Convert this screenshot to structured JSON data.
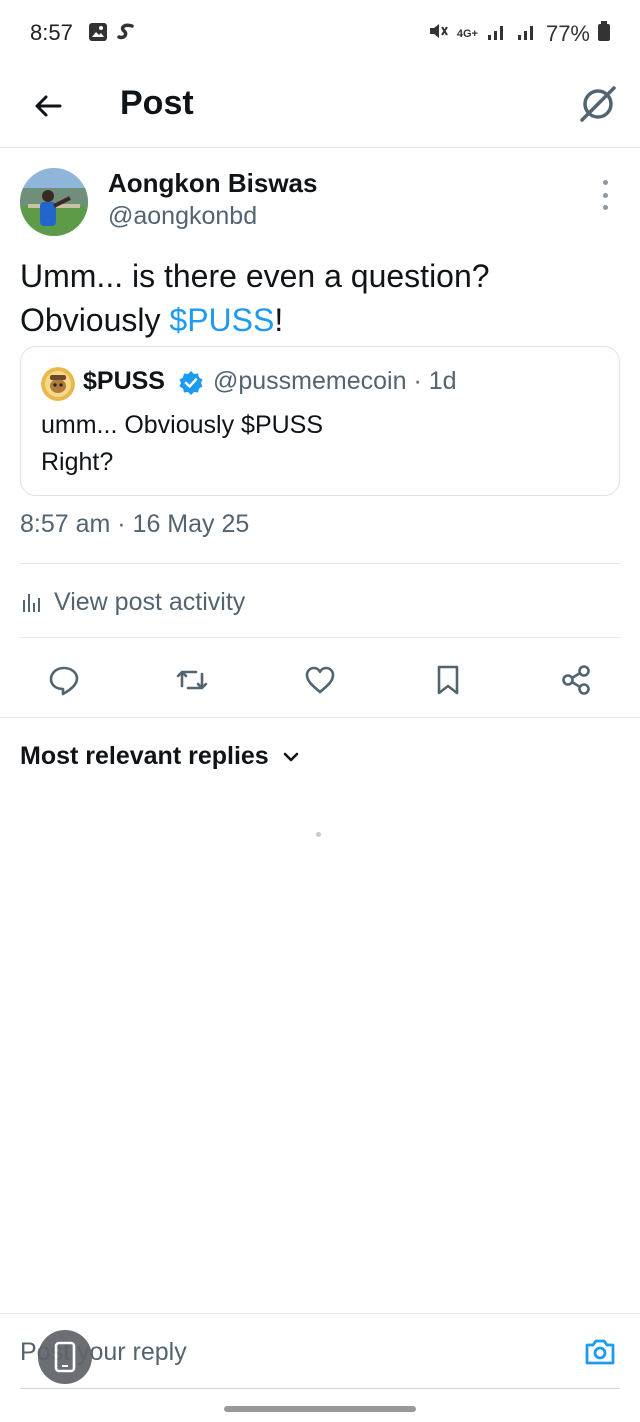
{
  "status_bar": {
    "time": "8:57",
    "battery": "77%",
    "network": "4G+"
  },
  "header": {
    "title": "Post"
  },
  "post": {
    "author_name": "Aongkon Biswas",
    "author_handle": "@aongkonbd",
    "text_before": "Umm... is there even a question? Obviously ",
    "cashtag": "$PUSS",
    "text_after": "!",
    "timestamp": "8:57 am · 16 May 25"
  },
  "quote": {
    "name": "$PUSS",
    "handle_time": "@pussmemecoin · 1d",
    "text": "umm... Obviously $PUSS\nRight?"
  },
  "activity": {
    "label": "View post activity"
  },
  "replies": {
    "sort_label": "Most relevant replies"
  },
  "reply_bar": {
    "placeholder": "Post your reply"
  },
  "icons": {
    "back": "arrow-left-icon",
    "grok": "grok-icon",
    "reply": "reply-icon",
    "repost": "repost-icon",
    "like": "heart-icon",
    "bookmark": "bookmark-icon",
    "share": "share-icon",
    "camera": "camera-icon",
    "verified": "verified-badge-icon"
  },
  "colors": {
    "accent": "#1d9bf0",
    "text": "#0f1419",
    "muted": "#536471"
  }
}
